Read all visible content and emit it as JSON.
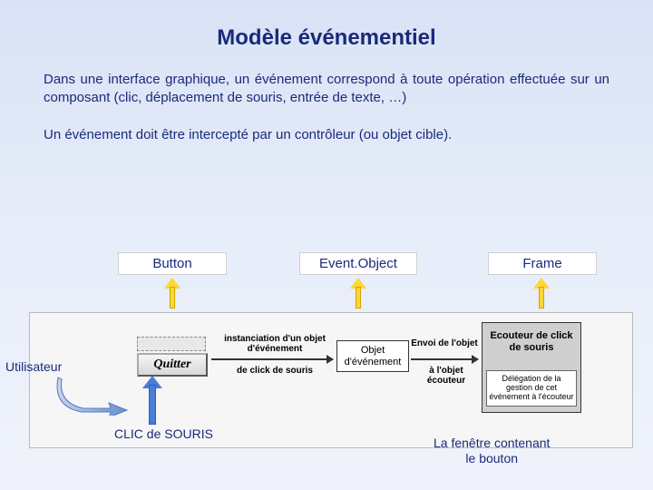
{
  "title": "Modèle événementiel",
  "para1": "Dans une interface graphique, un événement correspond à toute opération effectuée sur un composant (clic, déplacement de souris, entrée de texte, …)",
  "para2": "Un événement doit être intercepté par un contrôleur (ou objet cible).",
  "labels": {
    "button": "Button",
    "eventObject": "Event.Object",
    "frame": "Frame"
  },
  "diagram": {
    "quitButton": "Quitter",
    "midBox": "Objet d'événement",
    "rightBox": "Ecouteur de click de souris",
    "rightBoxSub": "Délégation de la gestion de cet événement à l'écouteur",
    "edge1": "instanciation d'un objet d'événement",
    "edge2": "de click de souris",
    "edge3": "Envoi de l'objet",
    "edge4": "à l'objet écouteur"
  },
  "utilisateur": "Utilisateur",
  "clic": "CLIC de SOURIS",
  "fenetre": "La fenêtre contenant\nle bouton"
}
